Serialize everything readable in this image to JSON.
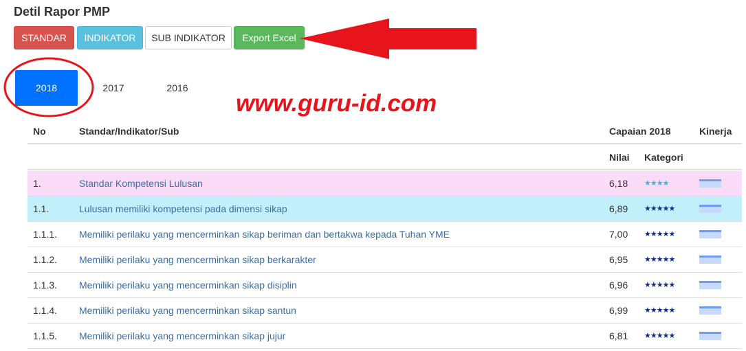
{
  "page": {
    "title": "Detil Rapor PMP"
  },
  "buttons": {
    "standar": "STANDAR",
    "indikator": "INDIKATOR",
    "sub_indikator": "SUB INDIKATOR",
    "export": "Export Excel"
  },
  "tabs": [
    {
      "label": "2018",
      "active": true
    },
    {
      "label": "2017",
      "active": false
    },
    {
      "label": "2016",
      "active": false
    }
  ],
  "watermark": "www.guru-id.com",
  "table": {
    "headers": {
      "no": "No",
      "standar": "Standar/Indikator/Sub",
      "capaian": "Capaian 2018",
      "kinerja": "Kinerja",
      "nilai": "Nilai",
      "kategori": "Kategori"
    },
    "rows": [
      {
        "no": "1.",
        "name": "Standar Kompetensi Lulusan",
        "nilai": "6,18",
        "stars": "★★★★",
        "row_color": "#fadcf8",
        "star_color": "#3bb3e6"
      },
      {
        "no": "1.1.",
        "name": "Lulusan memiliki kompetensi pada dimensi sikap",
        "nilai": "6,89",
        "stars": "★★★★★",
        "row_color": "#c2f0fa",
        "star_color": "#0c2c8a"
      },
      {
        "no": "1.1.1.",
        "name": "Memiliki perilaku yang mencerminkan sikap beriman dan bertakwa kepada Tuhan YME",
        "nilai": "7,00",
        "stars": "★★★★★",
        "row_color": "#ffffff",
        "star_color": "#0c2c8a"
      },
      {
        "no": "1.1.2.",
        "name": "Memiliki perilaku yang mencerminkan sikap berkarakter",
        "nilai": "6,95",
        "stars": "★★★★★",
        "row_color": "#ffffff",
        "star_color": "#0c2c8a"
      },
      {
        "no": "1.1.3.",
        "name": "Memiliki perilaku yang mencerminkan sikap disiplin",
        "nilai": "6,96",
        "stars": "★★★★★",
        "row_color": "#ffffff",
        "star_color": "#0c2c8a"
      },
      {
        "no": "1.1.4.",
        "name": "Memiliki perilaku yang mencerminkan sikap santun",
        "nilai": "6,99",
        "stars": "★★★★★",
        "row_color": "#ffffff",
        "star_color": "#0c2c8a"
      },
      {
        "no": "1.1.5.",
        "name": "Memiliki perilaku yang mencerminkan sikap jujur",
        "nilai": "6,81",
        "stars": "★★★★★",
        "row_color": "#ffffff",
        "star_color": "#0c2c8a"
      }
    ]
  },
  "colors": {
    "standar_btn": "#d9534f",
    "indikator_btn": "#5bc0de",
    "export_btn": "#5cb85c",
    "active_tab": "#0072ff",
    "annotation": "#e8141b"
  }
}
